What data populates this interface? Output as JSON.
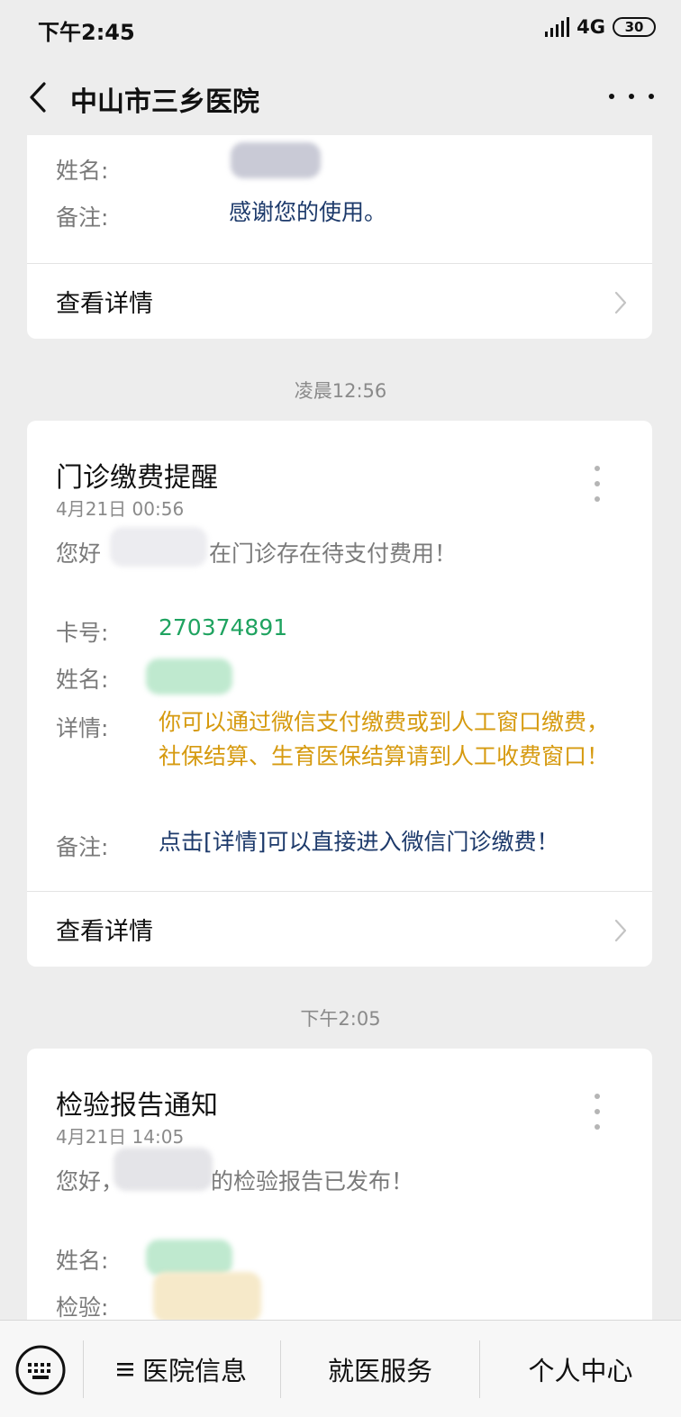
{
  "status": {
    "time": "下午2:45",
    "network": "4G",
    "battery": "30"
  },
  "header": {
    "title": "中山市三乡医院"
  },
  "card1": {
    "name_label": "姓名:",
    "remark_label": "备注:",
    "remark_value": "感谢您的使用。",
    "detail_link": "查看详情"
  },
  "timestamps": [
    "凌晨12:56",
    "下午2:05"
  ],
  "card2": {
    "title": "门诊缴费提醒",
    "date": "4月21日  00:56",
    "greeting_prefix": "您好",
    "greeting_suffix": "在门诊存在待支付费用！",
    "card_label": "卡号:",
    "card_value": "270374891",
    "name_label": "姓名:",
    "detail_label": "详情:",
    "detail_value": "你可以通过微信支付缴费或到人工窗口缴费，社保结算、生育医保结算请到人工收费窗口！",
    "remark_label": "备注:",
    "remark_value": "点击[详情]可以直接进入微信门诊缴费！",
    "detail_link": "查看详情"
  },
  "card3": {
    "title": "检验报告通知",
    "date": "4月21日  14:05",
    "greeting_prefix": "您好，",
    "greeting_suffix": "的检验报告已发布！",
    "name_label": "姓名:",
    "test_label": "检验:"
  },
  "bottom_menu": {
    "items": [
      "医院信息",
      "就医服务",
      "个人中心"
    ],
    "icons": {
      "keyboard": "keyboard-icon",
      "list": "list-icon"
    }
  },
  "colors": {
    "accent_blue": "#1d3a6b",
    "accent_green": "#1fa360",
    "accent_orange": "#d69a0f"
  }
}
